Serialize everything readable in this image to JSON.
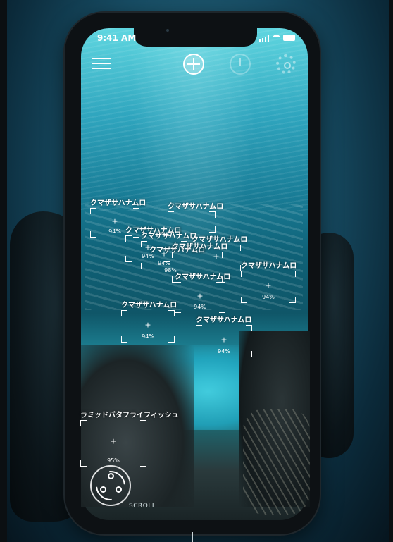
{
  "status_bar": {
    "time": "9:41 AM"
  },
  "toolbar": {
    "menu_icon": "hamburger-menu-icon",
    "scan_icon": "crosshair-target-icon",
    "history_icon": "history-clock-icon",
    "settings_icon": "gear-icon"
  },
  "detections": [
    {
      "label": "クマザサハナムロ",
      "confidence": "94%"
    },
    {
      "label": "クマザサハナムロ",
      "confidence": "94%"
    },
    {
      "label": "クマザサハナムロ",
      "confidence": "94%"
    },
    {
      "label": "クマザサハナムロ",
      "confidence": "94%"
    },
    {
      "label": "クマザサハナムロ",
      "confidence": "98%"
    },
    {
      "label": "クマザサハナムロ",
      "confidence": "94%"
    },
    {
      "label": "クマザサハナムロ",
      "confidence": "94%"
    },
    {
      "label": "クマザサハナムロ",
      "confidence": "94%"
    },
    {
      "label": "クマザサハナムロ",
      "confidence": "94%"
    },
    {
      "label": "クマザサハナムロ",
      "confidence": "94%"
    },
    {
      "label": "クマザサハナムロ",
      "confidence": "94%"
    },
    {
      "label": "ラミッドバタフライフィッシュ",
      "confidence": "95%"
    }
  ],
  "scroll_button": {
    "label": "SCROLL",
    "icon": "rotate-scroll-icon"
  },
  "colors": {
    "overlay": "#ffffff",
    "water_top": "#5fd6e0",
    "water_deep": "#0f5668"
  }
}
